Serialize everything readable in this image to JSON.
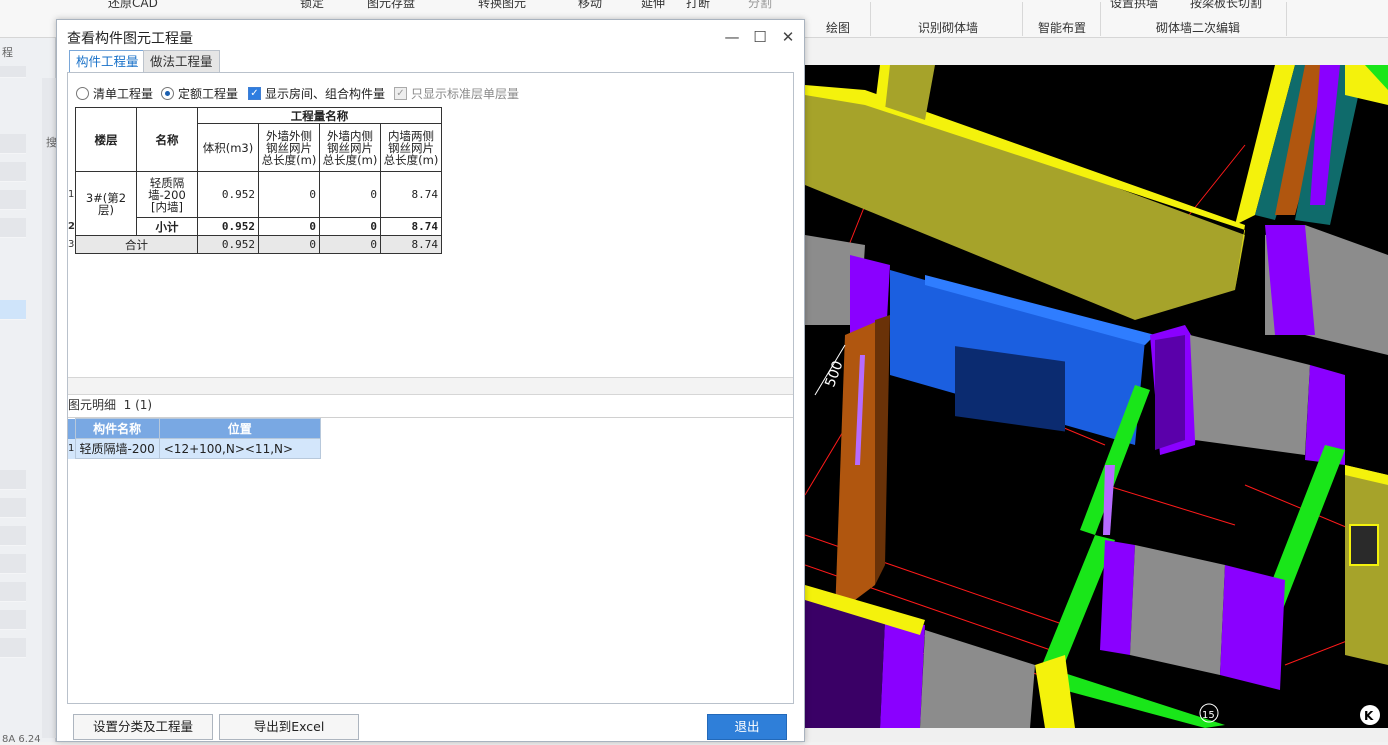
{
  "ribbon": {
    "top_items": [
      "还原CAD",
      "锁定",
      "图元存盘",
      "转换图元",
      "移动",
      "延伸",
      "打断",
      "分割"
    ],
    "groups": [
      "绘图",
      "识别砌体墙",
      "智能布置",
      "砌体墙二次编辑"
    ],
    "extra_items": [
      "设置拱墙",
      "按梁板长切割"
    ]
  },
  "background": {
    "left_labels": [
      "程",
      "搜"
    ],
    "bottom_left_text": "8A 6.24"
  },
  "dialog": {
    "title": "查看构件图元工程量",
    "tabs": [
      {
        "label": "构件工程量",
        "active": true
      },
      {
        "label": "做法工程量",
        "active": false
      }
    ],
    "options": {
      "list_qty": "清单工程量",
      "quota_qty": "定额工程量",
      "show_room": "显示房间、组合构件量",
      "std_floor": "只显示标准层单层量"
    },
    "table": {
      "header_group": "工程量名称",
      "col_floor": "楼层",
      "col_name": "名称",
      "col_volume": "体积(m3)",
      "col_outer_outside": "外墙外侧钢丝网片总长度(m)",
      "col_outer_inside": "外墙内侧钢丝网片总长度(m)",
      "col_inner_both": "内墙两侧钢丝网片总长度(m)",
      "rows": [
        {
          "no": "1",
          "floor": "3#(第2层)",
          "name": "轻质隔墙-200 [内墙]",
          "volume": "0.952",
          "outer_outside": "0",
          "outer_inside": "0",
          "inner_both": "8.74"
        },
        {
          "no": "2",
          "name": "小计",
          "volume": "0.952",
          "outer_outside": "0",
          "outer_inside": "0",
          "inner_both": "8.74"
        },
        {
          "no": "3",
          "name": "合计",
          "volume": "0.952",
          "outer_outside": "0",
          "outer_inside": "0",
          "inner_both": "8.74"
        }
      ]
    },
    "detail": {
      "label": "图元明细",
      "count": "1 (1)",
      "col_name": "构件名称",
      "col_pos": "位置",
      "rows": [
        {
          "no": "1",
          "name": "轻质隔墙-200",
          "position": "<12+100,N><11,N>"
        }
      ]
    },
    "buttons": {
      "classify": "设置分类及工程量",
      "export": "导出到Excel",
      "exit": "退出"
    }
  },
  "viewport": {
    "dimension_label": "500",
    "corner_label": "K",
    "axis_label": "15",
    "colors": {
      "beam_yellow": "#f4f20c",
      "wall_olive": "#a6a32a",
      "wall_purple": "#8a00ff",
      "wall_gray": "#8c8c8c",
      "wall_green": "#19e619",
      "wall_blue": "#1b5fe0",
      "wall_brown": "#b0560f",
      "wall_teal": "#0f6b6b",
      "grid_red": "#ff1a1a"
    }
  }
}
